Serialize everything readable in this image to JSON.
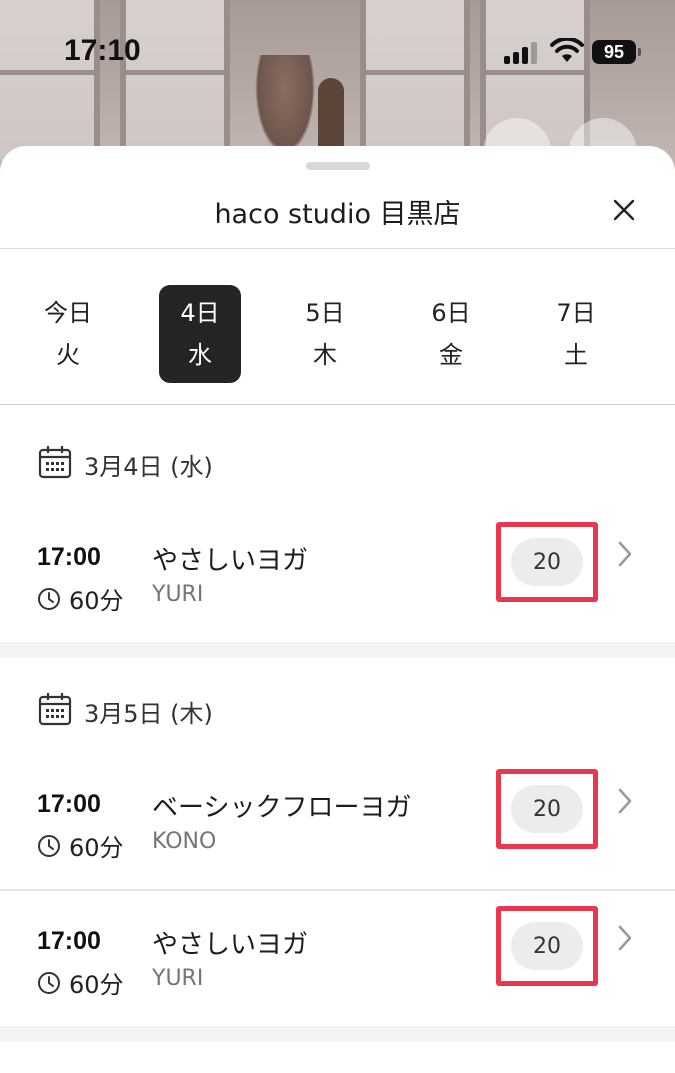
{
  "status_bar": {
    "time": "17:10",
    "battery": "95"
  },
  "sheet": {
    "title": "haco studio 目黒店",
    "close_icon": "close-icon"
  },
  "date_tabs": [
    {
      "day": "今日",
      "weekday": "火",
      "active": false
    },
    {
      "day": "4日",
      "weekday": "水",
      "active": true
    },
    {
      "day": "5日",
      "weekday": "木",
      "active": false
    },
    {
      "day": "6日",
      "weekday": "金",
      "active": false
    },
    {
      "day": "7日",
      "weekday": "土",
      "active": false
    }
  ],
  "sections": [
    {
      "date": "3月4日 (水)",
      "lessons": [
        {
          "time": "17:00",
          "duration": "60分",
          "name": "やさしいヨガ",
          "instructor": "YURI",
          "capacity": "20"
        }
      ]
    },
    {
      "date": "3月5日 (木)",
      "lessons": [
        {
          "time": "17:00",
          "duration": "60分",
          "name": "ベーシックフローヨガ",
          "instructor": "KONO",
          "capacity": "20"
        },
        {
          "time": "17:00",
          "duration": "60分",
          "name": "やさしいヨガ",
          "instructor": "YURI",
          "capacity": "20"
        }
      ]
    }
  ],
  "colors": {
    "active_tab": "#242424",
    "highlight_border": "#e8384f",
    "capacity_pill": "#ececec",
    "instructor_text": "#757575"
  }
}
